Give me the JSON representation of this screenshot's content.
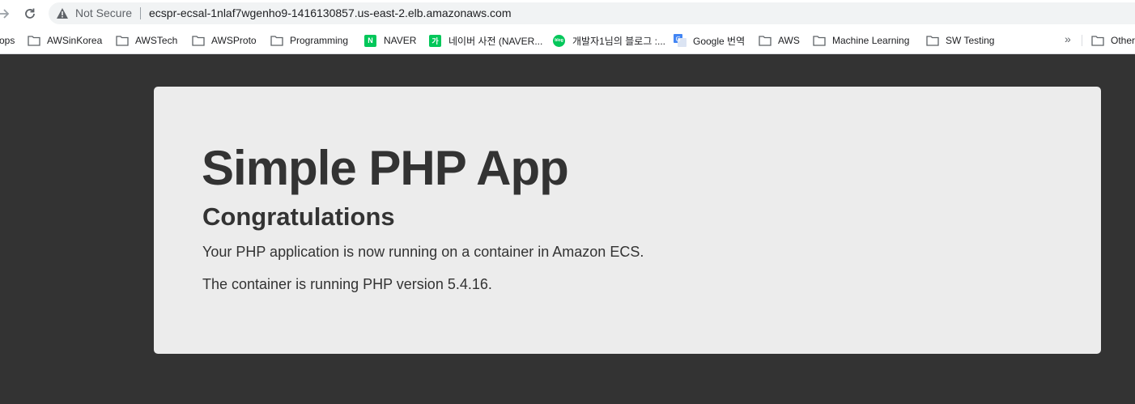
{
  "browser": {
    "security_label": "Not Secure",
    "url": "ecspr-ecsal-1nlaf7wgenho9-1416130857.us-east-2.elb.amazonaws.com"
  },
  "bookmarks": {
    "items": [
      {
        "label": "ops",
        "icon": "none"
      },
      {
        "label": "AWSinKorea",
        "icon": "folder-icon"
      },
      {
        "label": "AWSTech",
        "icon": "folder-icon"
      },
      {
        "label": "AWSProto",
        "icon": "folder-icon"
      },
      {
        "label": "Programming",
        "icon": "folder-icon"
      },
      {
        "label": "NAVER",
        "icon": "naver-icon",
        "badge": "N",
        "color": "#03c75a"
      },
      {
        "label": "네이버 사전 (NAVER...",
        "icon": "naver-dict-icon",
        "badge": "가",
        "color": "#03c75a"
      },
      {
        "label": "개발자1님의 블로그 :...",
        "icon": "blog-icon",
        "badge": "blog",
        "color": "#03c75a"
      },
      {
        "label": "Google 번역",
        "icon": "google-translate-icon",
        "color": "#4285f4"
      },
      {
        "label": "AWS",
        "icon": "folder-icon"
      },
      {
        "label": "Machine Learning",
        "icon": "folder-icon"
      },
      {
        "label": "SW Testing",
        "icon": "folder-icon"
      }
    ],
    "overflow_label": "»",
    "other_label": "Other"
  },
  "page": {
    "title": "Simple PHP App",
    "subtitle": "Congratulations",
    "paragraphs": [
      "Your PHP application is now running on a container in Amazon ECS.",
      "The container is running PHP version 5.4.16."
    ]
  },
  "colors": {
    "page_background": "#333333",
    "card_background": "#ececec",
    "text": "#333333"
  }
}
